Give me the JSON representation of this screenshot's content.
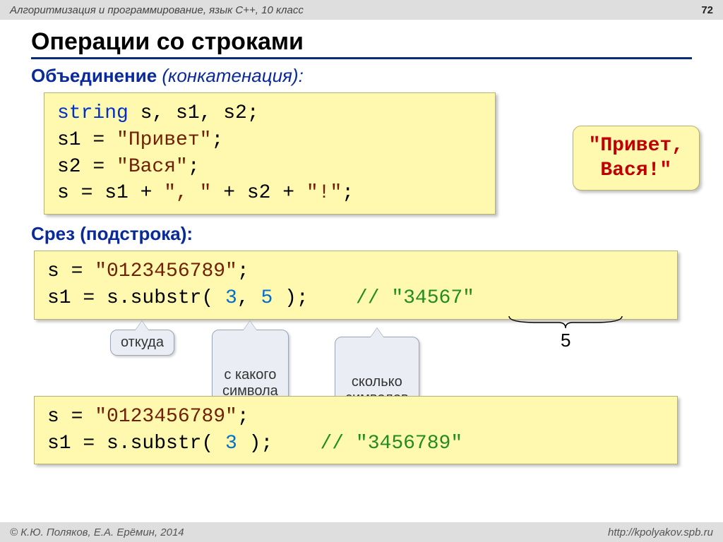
{
  "header": {
    "course": "Алгоритмизация и программирование, язык C++, 10 класс",
    "page": "72"
  },
  "title": "Операции со строками",
  "sec1": {
    "label_blue": "Объединение",
    "label_paren": "(конкатенация):",
    "code_l1_kw": "string",
    "code_l1_rest": " s, s1, s2;",
    "code_l2a": "s1 = ",
    "code_l2s": "\"Привет\"",
    "code_l2b": ";",
    "code_l3a": "s2 = ",
    "code_l3s": "\"Вася\"",
    "code_l3b": ";",
    "code_l4a": "s = s1 + ",
    "code_l4s1": "\", \"",
    "code_l4b": " + s2 + ",
    "code_l4s2": "\"!\"",
    "code_l4c": ";",
    "result_l1": "\"Привет,",
    "result_l2": "Вася!\""
  },
  "sec2": {
    "label": "Срез (подстрока):",
    "code1_l1a": "s = ",
    "code1_l1s": "\"0123456789\"",
    "code1_l1b": ";",
    "code1_l2a": "s1 = s.substr( ",
    "code1_l2n1": "3",
    "code1_l2m": ", ",
    "code1_l2n2": "5",
    "code1_l2b": " );    ",
    "code1_l2c": "// ",
    "code1_l2cs": "\"34567\"",
    "brace_label": "5",
    "callout1": "откуда",
    "callout2": "с какого\nсимвола",
    "callout3": "сколько\nсимволов",
    "code2_l1a": "s = ",
    "code2_l1s": "\"0123456789\"",
    "code2_l1b": ";",
    "code2_l2a": "s1 = s.substr( ",
    "code2_l2n1": "3",
    "code2_l2b": " );    ",
    "code2_l2c": "// ",
    "code2_l2cs": "\"3456789\""
  },
  "footer": {
    "left": "© К.Ю. Поляков, Е.А. Ерёмин, 2014",
    "right": "http://kpolyakov.spb.ru"
  }
}
